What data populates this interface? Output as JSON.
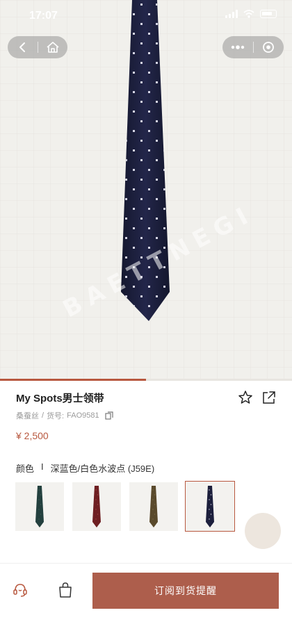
{
  "status_bar": {
    "time": "17:07"
  },
  "hero": {
    "watermark": "BAETTNEGI",
    "product_image": "navy-polka-dot-tie",
    "gallery_progress": 0.5
  },
  "nav": {
    "back_icon": "chevron-left-icon",
    "home_icon": "home-icon",
    "more_icon": "more-dots-icon",
    "close_icon": "target-icon"
  },
  "product": {
    "title": "My Spots男士领带",
    "material": "桑蚕丝",
    "sku_label": "货号:",
    "sku": "FAO9581",
    "price": "¥ 2,500"
  },
  "color": {
    "label": "颜色",
    "separator": "I",
    "selected_value": "深蓝色/白色水波点 (J59E)",
    "swatches": [
      {
        "name": "dark-green",
        "color": "#23403e",
        "dot": "#3d5a57"
      },
      {
        "name": "red",
        "color": "#6e1f22",
        "dot": "#a24a40"
      },
      {
        "name": "brown",
        "color": "#5a4a2c",
        "dot": "#7a6a46"
      },
      {
        "name": "navy",
        "color": "#1c1f3c",
        "dot": "#cfd0e0",
        "selected": true
      }
    ]
  },
  "bottom_bar": {
    "cs_icon": "customer-service-icon",
    "bag_icon": "shopping-bag-icon",
    "cta_label": "订阅到货提醒"
  },
  "colors": {
    "accent": "#b8583f",
    "cta": "#ad5e4c"
  }
}
